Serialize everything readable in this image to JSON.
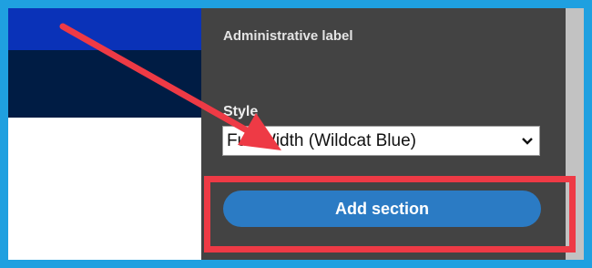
{
  "panel": {
    "administrative_label": "Administrative label",
    "style_label": "Style",
    "style_select": {
      "selected": "Full Width (Wildcat Blue)"
    },
    "add_section_label": "Add section"
  },
  "colors": {
    "frame_border": "#1fa0e0",
    "band_blue": "#0a32b8",
    "band_navy": "#001c44",
    "panel_bg": "#434343",
    "button_bg": "#2b7bc4",
    "annotation_red": "#ee3a45"
  },
  "icons": {
    "select_chevron": "chevron-down-icon",
    "annotation_arrow": "arrow-annotation-icon"
  }
}
